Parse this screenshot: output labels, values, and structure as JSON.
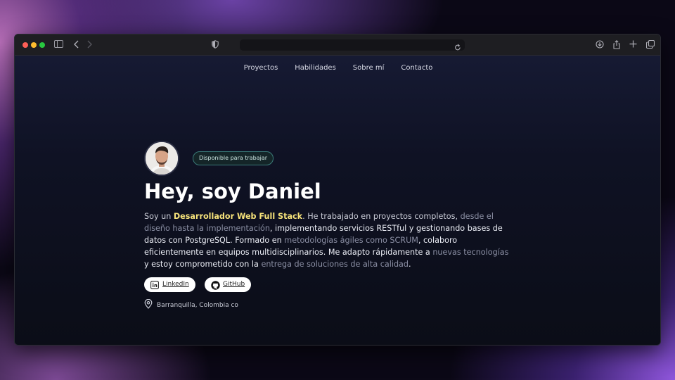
{
  "nav": {
    "items": [
      "Proyectos",
      "Habilidades",
      "Sobre mí",
      "Contacto"
    ]
  },
  "profile": {
    "badge": "Disponible para trabajar",
    "title": "Hey, soy Daniel",
    "bio": {
      "p1": "Soy un ",
      "p2": "Desarrollador Web Full Stack",
      "p3": ". He trabajado en proyectos completos, ",
      "p4": "desde el diseño hasta la implementación",
      "p5": ", implementando servicios RESTful y gestionando bases de datos con PostgreSQL. Formado en ",
      "p6": "metodologías ágiles como SCRUM",
      "p7": ", colaboro eficientemente en equipos multidisciplinarios. Me adapto rápidamente a ",
      "p8": "nuevas tecnologías",
      "p9": " y estoy comprometido con la ",
      "p10": "entrega de soluciones de alta calidad",
      "p11": "."
    },
    "buttons": {
      "linkedin": "LinkedIn",
      "github": "GitHub"
    },
    "location": "Barranquilla, Colombia co"
  }
}
